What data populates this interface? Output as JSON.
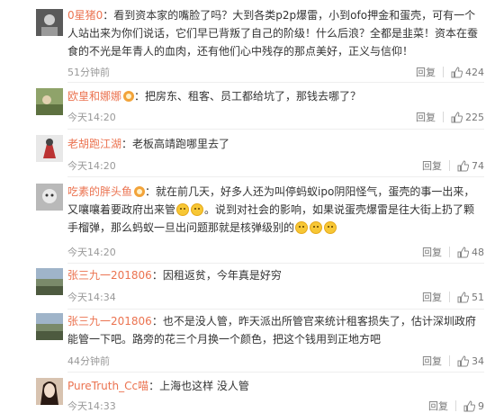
{
  "comments": [
    {
      "user": "0星猪0",
      "text": "看到资本家的嘴脸了吗？大到各类p2p爆雷，小到ofo押金和蛋壳，可有一个人站出来为你们说话，它们早已背叛了自己的阶级！什么后浪？全都是韭菜！资本在蚕食的不光是年青人的血肉，还有他们心中残存的那点美好，正义与信仰！",
      "time": "51分钟前",
      "reply": "回复",
      "likes": "424"
    },
    {
      "user": "欧皇和娜娜",
      "text": "把房东、租客、员工都给坑了，那钱去哪了？",
      "time": "今天14:20",
      "reply": "回复",
      "likes": "225"
    },
    {
      "user": "老胡跑江湖",
      "text": "老板高靖跑哪里去了",
      "time": "今天14:20",
      "reply": "回复",
      "likes": "74"
    },
    {
      "user": "吃素的胖头鱼",
      "text_a": "就在前几天，好多人还为叫停蚂蚁ipo阴阳怪气，蛋壳的事一出来，又嚷嚷着要政府出来管",
      "text_b": "。说到对社会的影响，如果说蛋壳爆雷是往大街上扔了颗手榴弹，那么蚂蚁一旦出问题那就是核弹级别的",
      "time": "今天14:20",
      "reply": "回复",
      "likes": "48"
    },
    {
      "user": "张三九一201806",
      "text": "因租返贫，今年真是好穷",
      "time": "今天14:34",
      "reply": "回复",
      "likes": "51"
    },
    {
      "user": "张三九一201806",
      "text": "也不是没人管，昨天派出所管官来统计租客损失了，估计深圳政府能管一下吧。路旁的花三个月换一个颜色，把这个钱用到正地方吧",
      "time": "44分钟前",
      "reply": "回复",
      "likes": "34"
    },
    {
      "user": "PureTruth_Cc喵",
      "text": "上海也这样 没人管",
      "time": "今天14:33",
      "reply": "回复",
      "likes": "9"
    }
  ],
  "colors": {
    "username": "#eb7350",
    "meta": "#999999",
    "divider": "#eeeeee"
  },
  "icons": {
    "like": "thumbs-up-icon",
    "badge": "member-badge-icon",
    "emoji": "emoji-icon"
  }
}
